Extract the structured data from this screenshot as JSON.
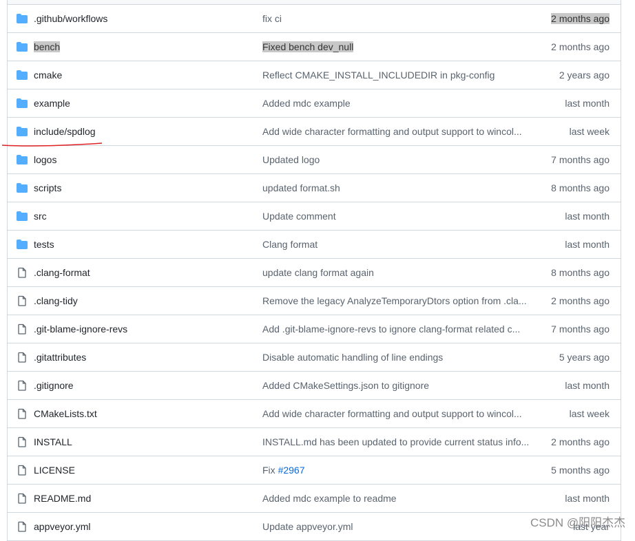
{
  "colors": {
    "folder": "#54aeff",
    "link": "#0969da",
    "annotation": "#e02020"
  },
  "rows": [
    {
      "type": "folder",
      "name": ".github/workflows",
      "message": "fix ci",
      "age": "2 months ago",
      "sel": [
        "age"
      ]
    },
    {
      "type": "folder",
      "name": "bench",
      "message": "Fixed bench dev_null",
      "age": "2 months ago",
      "sel": [
        "name",
        "message"
      ]
    },
    {
      "type": "folder",
      "name": "cmake",
      "message": "Reflect CMAKE_INSTALL_INCLUDEDIR in pkg-config",
      "age": "2 years ago"
    },
    {
      "type": "folder",
      "name": "example",
      "message": "Added mdc example",
      "age": "last month"
    },
    {
      "type": "folder",
      "name": "include/spdlog",
      "message": "Add wide character formatting and output support to wincol...",
      "age": "last week",
      "underlined": true
    },
    {
      "type": "folder",
      "name": "logos",
      "message": "Updated logo",
      "age": "7 months ago"
    },
    {
      "type": "folder",
      "name": "scripts",
      "message": "updated format.sh",
      "age": "8 months ago"
    },
    {
      "type": "folder",
      "name": "src",
      "message": "Update comment",
      "age": "last month"
    },
    {
      "type": "folder",
      "name": "tests",
      "message": "Clang format",
      "age": "last month"
    },
    {
      "type": "file",
      "name": ".clang-format",
      "message": "update clang format again",
      "age": "8 months ago"
    },
    {
      "type": "file",
      "name": ".clang-tidy",
      "message": "Remove the legacy AnalyzeTemporaryDtors option from .cla...",
      "age": "2 months ago"
    },
    {
      "type": "file",
      "name": ".git-blame-ignore-revs",
      "message": "Add .git-blame-ignore-revs to ignore clang-format related c...",
      "age": "7 months ago"
    },
    {
      "type": "file",
      "name": ".gitattributes",
      "message": "Disable automatic handling of line endings",
      "age": "5 years ago"
    },
    {
      "type": "file",
      "name": ".gitignore",
      "message": "Added CMakeSettings.json to gitignore",
      "age": "last month"
    },
    {
      "type": "file",
      "name": "CMakeLists.txt",
      "message": "Add wide character formatting and output support to wincol...",
      "age": "last week"
    },
    {
      "type": "file",
      "name": "INSTALL",
      "message": "INSTALL.md has been updated to provide current status info...",
      "age": "2 months ago"
    },
    {
      "type": "file",
      "name": "LICENSE",
      "message": "Fix ",
      "message_link": "#2967",
      "age": "5 months ago"
    },
    {
      "type": "file",
      "name": "README.md",
      "message": "Added mdc example to readme",
      "age": "last month"
    },
    {
      "type": "file",
      "name": "appveyor.yml",
      "message": "Update appveyor.yml",
      "age": "last year"
    }
  ],
  "watermark": "CSDN @阳阳杰杰"
}
